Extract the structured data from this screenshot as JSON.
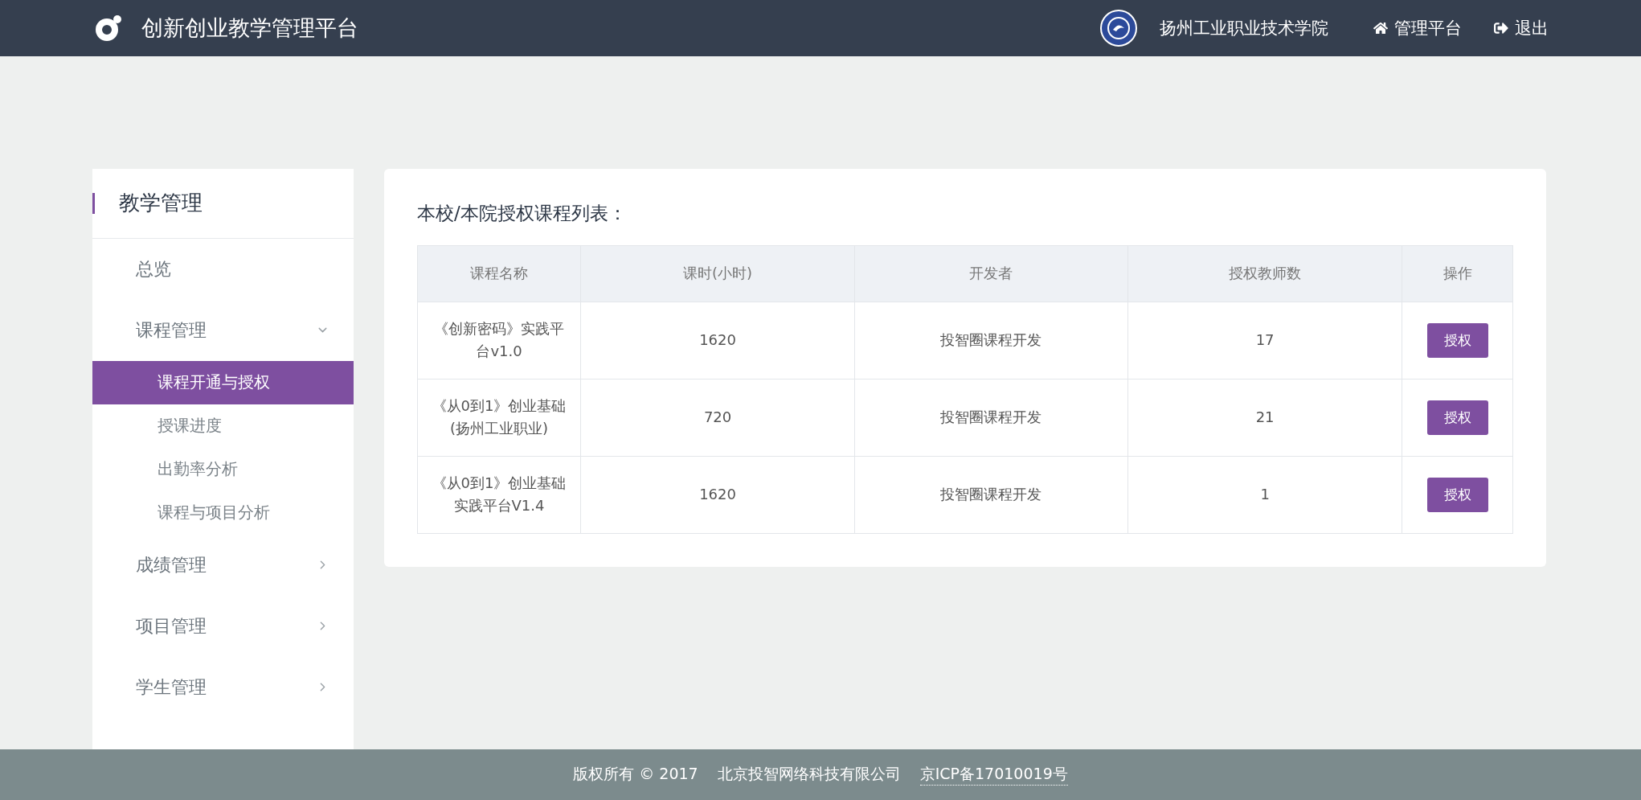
{
  "header": {
    "title": "创新创业教学管理平台",
    "school": "扬州工业职业技术学院",
    "nav": [
      {
        "kind": "home",
        "label": "管理平台"
      },
      {
        "kind": "logout",
        "label": "退出"
      }
    ]
  },
  "sidebar": {
    "title": "教学管理",
    "items": [
      {
        "kind": "link",
        "label": "总览"
      },
      {
        "kind": "group",
        "label": "课程管理",
        "expanded": true,
        "children": [
          {
            "label": "课程开通与授权",
            "selected": true
          },
          {
            "label": "授课进度",
            "selected": false
          },
          {
            "label": "出勤率分析",
            "selected": false
          },
          {
            "label": "课程与项目分析",
            "selected": false
          }
        ]
      },
      {
        "kind": "group",
        "label": "成绩管理",
        "expanded": false
      },
      {
        "kind": "group",
        "label": "项目管理",
        "expanded": false
      },
      {
        "kind": "group",
        "label": "学生管理",
        "expanded": false
      }
    ]
  },
  "content": {
    "title": "本校/本院授权课程列表：",
    "table": {
      "columns": [
        "课程名称",
        "课时(小时)",
        "开发者",
        "授权教师数",
        "操作"
      ],
      "rows": [
        {
          "name": "《创新密码》实践平台v1.0",
          "hours": "1620",
          "developer": "投智圈课程开发",
          "teachers": "17",
          "action": "授权"
        },
        {
          "name": "《从0到1》创业基础(扬州工业职业)",
          "hours": "720",
          "developer": "投智圈课程开发",
          "teachers": "21",
          "action": "授权"
        },
        {
          "name": "《从0到1》创业基础实践平台V1.4",
          "hours": "1620",
          "developer": "投智圈课程开发",
          "teachers": "1",
          "action": "授权"
        }
      ]
    }
  },
  "footer": {
    "copyright": "版权所有 © 2017",
    "company": "北京投智网络科技有限公司",
    "icp": "京ICP备17010019号"
  }
}
